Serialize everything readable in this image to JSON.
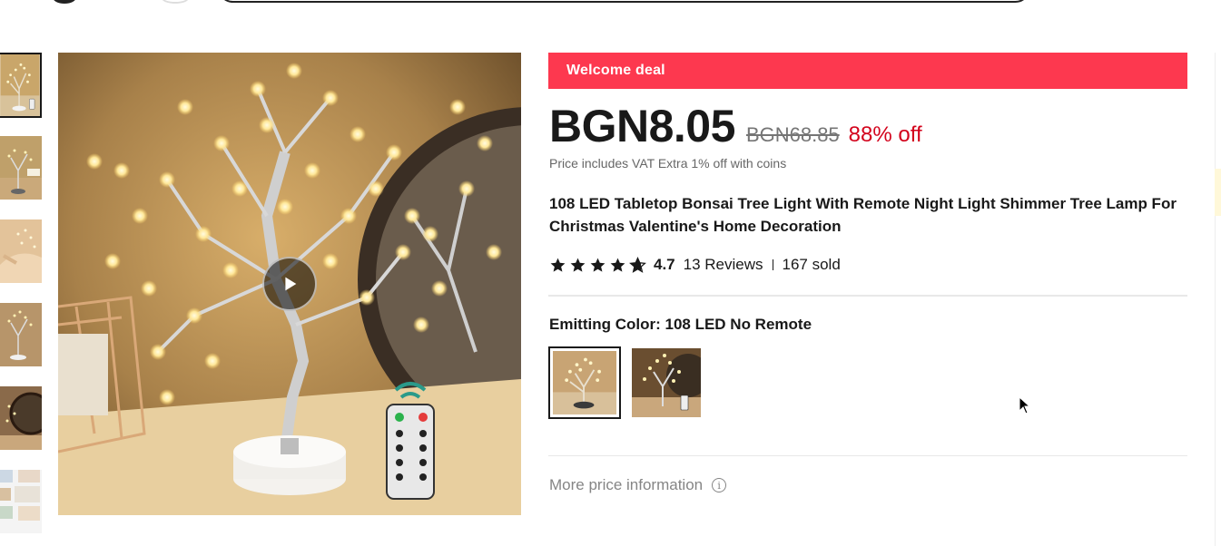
{
  "deal_banner": "Welcome deal",
  "price": {
    "current": "BGN8.05",
    "original": "BGN68.85",
    "discount": "88% off",
    "note": "Price includes VAT Extra 1% off with coins"
  },
  "product_title": "108 LED Tabletop Bonsai Tree Light With Remote Night Light Shimmer Tree Lamp For Christmas Valentine's Home Decoration",
  "rating": {
    "value": "4.7",
    "stars": 4.7,
    "reviews": "13 Reviews",
    "sold": "167 sold"
  },
  "sku": {
    "label": "Emitting Color: 108 LED No Remote",
    "selected_index": 0
  },
  "more_price_info": "More price information",
  "icons": {
    "play": "play-icon",
    "info": "info-icon",
    "star": "star-icon"
  },
  "colors": {
    "deal_bar": "#fd384f",
    "discount": "#d3031c",
    "text": "#191919",
    "muted": "#858585"
  }
}
